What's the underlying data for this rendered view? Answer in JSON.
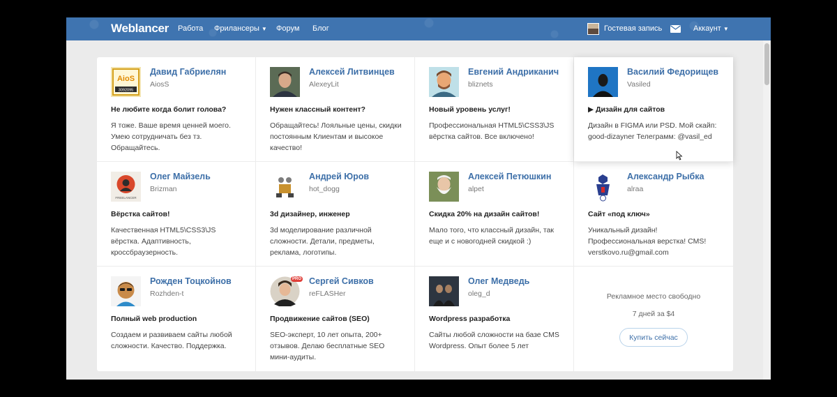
{
  "navbar": {
    "logo": "Weblancer",
    "links": [
      "Работа",
      "Фрилансеры",
      "Форум",
      "Блог"
    ],
    "guest": "Гостевая запись",
    "account": "Аккаунт"
  },
  "freelancers": [
    {
      "name": "Давид Габриелян",
      "login": "AiosS",
      "headline": "Не любите когда болит голова?",
      "description": "Я тоже. Ваше время ценней моего. Умею сотрудничать без тз. Обращайтесь."
    },
    {
      "name": "Алексей Литвинцев",
      "login": "AlexeyLit",
      "headline": "Нужен классный контент?",
      "description": "Обращайтесь! Лояльные цены, скидки постоянным Клиентам и высокое качество!"
    },
    {
      "name": "Евгений Андриканич",
      "login": "bliznets",
      "headline": "Новый уровень услуг!",
      "description": "Профессиональная HTML5\\CSS3\\JS вёрстка сайтов. Все включено!"
    },
    {
      "name": "Василий Федорищев",
      "login": "Vasiled",
      "headline": "▶ Дизайн для сайтов",
      "description": "Дизайн в FIGMA или PSD. Мой скайп: good-dizayner Телеграмм: @vasil_ed"
    },
    {
      "name": "Олег Майзель",
      "login": "Brizman",
      "headline": "Вёрстка сайтов!",
      "description": "Качественная HTML5\\CSS3\\JS вёрстка. Адаптивность, кроссбраузерность."
    },
    {
      "name": "Андрей Юров",
      "login": "hot_dogg",
      "headline": "3d дизайнер, инженер",
      "description": "3d моделирование различной сложности. Детали, предметы, реклама, логотипы."
    },
    {
      "name": "Алексей Петюшкин",
      "login": "alpet",
      "headline": "Скидка 20% на дизайн сайтов!",
      "description": "Мало того, что классный дизайн, так еще и с новогодней скидкой :)"
    },
    {
      "name": "Александр Рыбка",
      "login": "alraa",
      "headline": "Сайт «под ключ»",
      "description": "Уникальный дизайн! Профессиональная верстка! CMS! verstkovo.ru@gmail.com"
    },
    {
      "name": "Рожден Тоцкойнов",
      "login": "Rozhden-t",
      "headline": "Полный web production",
      "description": "Создаем и развиваем сайты любой сложности. Качество. Поддержка."
    },
    {
      "name": "Сергей Сивков",
      "login": "reFLASHer",
      "headline": "Продвижение сайтов (SEO)",
      "description": "SEO-эксперт, 10 лет опыта, 200+ отзывов. Делаю бесплатные SEO мини-аудиты."
    },
    {
      "name": "Олег Медведь",
      "login": "oleg_d",
      "headline": "Wordpress разработка",
      "description": "Сайты любой сложности на базе CMS Wordpress. Опыт более 5 лет"
    }
  ],
  "avatar_texts": {
    "aios_top": "AioS",
    "aios_bottom": "3092095",
    "freelancer": "FREELANCER",
    "pro": "PRO"
  },
  "ad": {
    "title": "Рекламное место свободно",
    "price": "7 дней за $4",
    "button": "Купить сейчас"
  },
  "colors": {
    "navbar": "#3f74b0",
    "link": "#3d6fa8",
    "background": "#ebebeb"
  }
}
